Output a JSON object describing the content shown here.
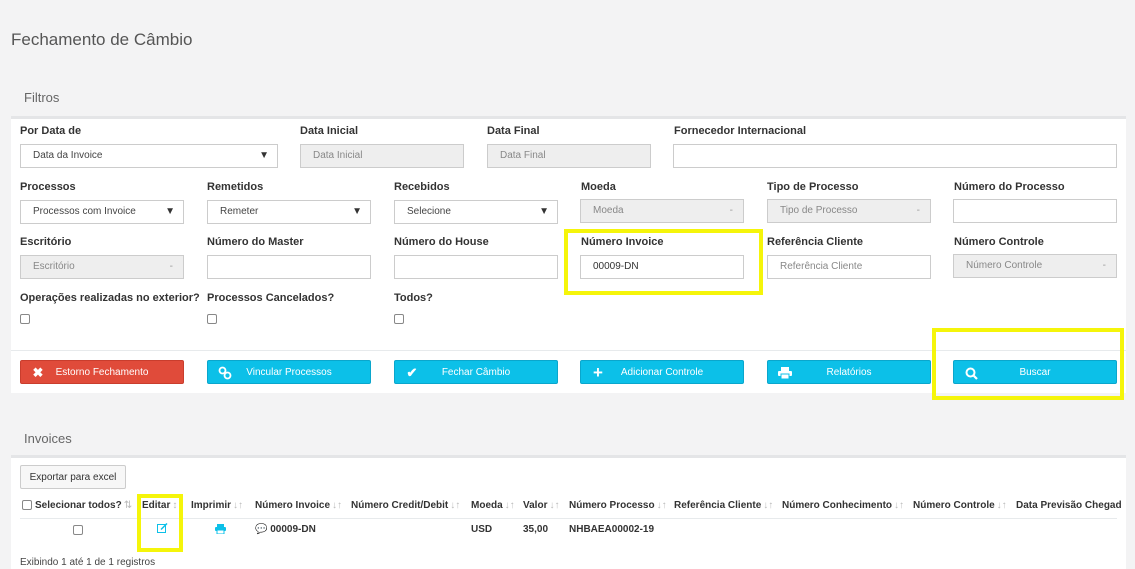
{
  "page_title": "Fechamento de Câmbio",
  "filters": {
    "section_title": "Filtros",
    "por_data": {
      "label": "Por Data de",
      "value": "Data da Invoice"
    },
    "data_inicial": {
      "label": "Data Inicial",
      "placeholder": "Data Inicial"
    },
    "data_final": {
      "label": "Data Final",
      "placeholder": "Data Final"
    },
    "fornecedor": {
      "label": "Fornecedor Internacional",
      "value": ""
    },
    "processos": {
      "label": "Processos",
      "value": "Processos com Invoice"
    },
    "remetidos": {
      "label": "Remetidos",
      "value": "Remeter"
    },
    "recebidos": {
      "label": "Recebidos",
      "value": "Selecione"
    },
    "moeda": {
      "label": "Moeda",
      "value": "Moeda"
    },
    "tipo_processo": {
      "label": "Tipo de Processo",
      "value": "Tipo de Processo"
    },
    "numero_processo": {
      "label": "Número do Processo",
      "value": ""
    },
    "escritorio": {
      "label": "Escritório",
      "value": "Escritório"
    },
    "numero_master": {
      "label": "Número do Master",
      "value": ""
    },
    "numero_house": {
      "label": "Número do House",
      "value": ""
    },
    "numero_invoice": {
      "label": "Número Invoice",
      "value": "00009-DN"
    },
    "referencia_cliente": {
      "label": "Referência Cliente",
      "placeholder": "Referência Cliente"
    },
    "numero_controle": {
      "label": "Número Controle",
      "value": "Número Controle"
    },
    "op_exterior": {
      "label": "Operações realizadas no exterior?"
    },
    "cancelados": {
      "label": "Processos Cancelados?"
    },
    "todos": {
      "label": "Todos?"
    }
  },
  "actions": {
    "estorno": "Estorno Fechamento",
    "vincular": "Vincular Processos",
    "fechar": "Fechar Câmbio",
    "adicionar": "Adicionar Controle",
    "relatorios": "Relatórios",
    "buscar": "Buscar"
  },
  "invoices": {
    "section_title": "Invoices",
    "export_label": "Exportar para excel",
    "columns": [
      "Selecionar todos?",
      "Editar",
      "Imprimir",
      "Número Invoice",
      "Número Credit/Debit",
      "Moeda",
      "Valor",
      "Número Processo",
      "Referência Cliente",
      "Número Conhecimento",
      "Número Controle",
      "Data Previsão Chegad"
    ],
    "rows": [
      {
        "numero_invoice": "00009-DN",
        "moeda": "USD",
        "valor": "35,00",
        "numero_processo": "NHBAEA00002-19"
      }
    ],
    "footer": "Exibindo 1 até 1 de 1 registros"
  },
  "colors": {
    "accent": "#0cc0e8",
    "danger": "#e04b3a",
    "highlight": "#f5f50a"
  }
}
